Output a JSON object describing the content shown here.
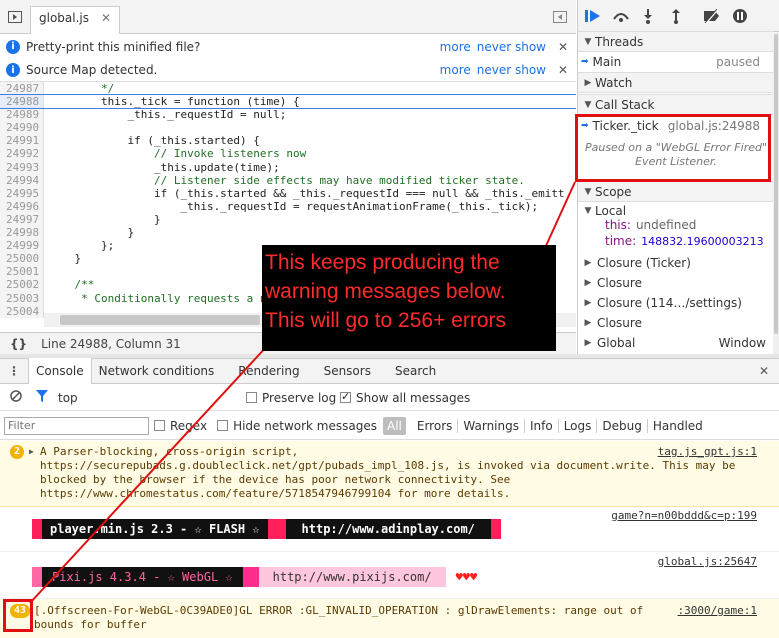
{
  "sources_tab": {
    "filename": "global.js"
  },
  "infobars": [
    {
      "text": "Pretty-print this minified file?",
      "more": "more",
      "never": "never show"
    },
    {
      "text": "Source Map detected.",
      "more": "more",
      "never": "never show"
    }
  ],
  "code_lines": [
    {
      "n": "24987",
      "t": "        */"
    },
    {
      "n": "24988",
      "t": "        this._tick = function (time) {"
    },
    {
      "n": "24989",
      "t": "            _this._requestId = null;"
    },
    {
      "n": "24990",
      "t": ""
    },
    {
      "n": "24991",
      "t": "            if (_this.started) {"
    },
    {
      "n": "24992",
      "t": "                // Invoke listeners now"
    },
    {
      "n": "24993",
      "t": "                _this.update(time);"
    },
    {
      "n": "24994",
      "t": "                // Listener side effects may have modified ticker state."
    },
    {
      "n": "24995",
      "t": "                if (_this.started && _this._requestId === null && _this._emitt"
    },
    {
      "n": "24996",
      "t": "                    _this._requestId = requestAnimationFrame(_this._tick);"
    },
    {
      "n": "24997",
      "t": "                }"
    },
    {
      "n": "24998",
      "t": "            }"
    },
    {
      "n": "24999",
      "t": "        };"
    },
    {
      "n": "25000",
      "t": "    }"
    },
    {
      "n": "25001",
      "t": ""
    },
    {
      "n": "25002",
      "t": "    /**"
    },
    {
      "n": "25003",
      "t": "     * Conditionally requests a new animation frame."
    },
    {
      "n": "25004",
      "t": ""
    }
  ],
  "status": {
    "position": "Line 24988, Column 31"
  },
  "right_panel": {
    "threads": "Threads",
    "main": "Main",
    "paused": "paused",
    "watch": "Watch",
    "call_stack": "Call Stack",
    "frame_fn": "Ticker._tick",
    "frame_loc": "global.js:24988",
    "paused_msg": "Paused on a \"WebGL Error Fired\" Event Listener.",
    "scope": "Scope",
    "local": "Local",
    "this_key": "this:",
    "this_val": "undefined",
    "time_key": "time:",
    "time_val": "148832.19600003213",
    "closures": [
      "Closure (Ticker)",
      "Closure",
      "Closure (114…/settings)",
      "Closure"
    ],
    "global": "Global",
    "global_val": "Window"
  },
  "console_tabs": [
    "Console",
    "Network conditions",
    "Rendering",
    "Sensors",
    "Search"
  ],
  "console_toolbar": {
    "context": "top",
    "preserve_log": "Preserve log",
    "show_all": "Show all messages"
  },
  "filterbar": {
    "placeholder": "Filter",
    "regex": "Regex",
    "hide_network": "Hide network messages",
    "all": "All",
    "levels": [
      "Errors",
      "Warnings",
      "Info",
      "Logs",
      "Debug",
      "Handled"
    ]
  },
  "messages": {
    "m1": {
      "count": "2",
      "lines": [
        "A Parser-blocking, cross-origin script,",
        "https://securepubads.g.doubleclick.net/gpt/pubads_impl_108.js, is invoked via document.write. This may be",
        "blocked by the browser if the device has poor network connectivity. See",
        "https://www.chromestatus.com/feature/5718547946799104 for more details."
      ],
      "source": "tag.js_gpt.js:1"
    },
    "m2": {
      "source": "game?n=n00bddd&c=p:199",
      "banner_left": "player.min.js 2.3 - ☆ FLASH ☆",
      "banner_right": "http://www.adinplay.com/"
    },
    "m3": {
      "source": "global.js:25647",
      "banner_left": "Pixi.js 4.3.4 - ☆ WebGL ☆",
      "banner_right": "http://www.pixijs.com/",
      "hearts": "♥♥♥"
    },
    "m4": {
      "count": "43",
      "lines": [
        "[.Offscreen-For-WebGL-0C39ADE0]GL ERROR :GL_INVALID_OPERATION : glDrawElements: range out of",
        "bounds for buffer"
      ],
      "source": ":3000/game:1"
    }
  },
  "annotation": {
    "lines": [
      "This keeps producing the",
      "warning messages below.",
      "This will go to 256+ errors"
    ],
    "color": "#e01010"
  }
}
